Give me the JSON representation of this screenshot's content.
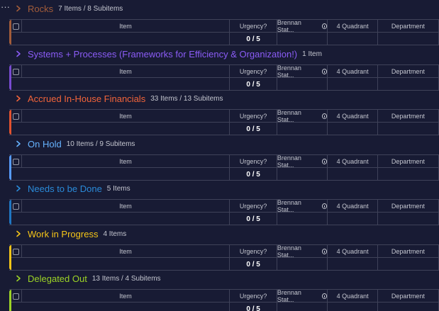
{
  "menu_glyph": "···",
  "columns": {
    "item": "Item",
    "urgency": "Urgency?",
    "brennan": "Brennan Stat...",
    "quadrant": "4 Quadrant",
    "department": "Department"
  },
  "groups": [
    {
      "title": "Rocks",
      "count": "7 Items / 8 Subitems",
      "progress": "0 / 5",
      "color": "#a25c3a",
      "title_color": "#a25c3a"
    },
    {
      "title": "Systems + Processes (Frameworks for Efficiency & Organization!)",
      "count": "1 Item",
      "progress": "0 / 5",
      "color": "#784bd1",
      "title_color": "#8b5cf6"
    },
    {
      "title": "Accrued In-House Financials",
      "count": "33 Items / 13 Subitems",
      "progress": "0 / 5",
      "color": "#e2522f",
      "title_color": "#f2643a"
    },
    {
      "title": "On Hold",
      "count": "10 Items / 9 Subitems",
      "progress": "0 / 5",
      "color": "#579bfc",
      "title_color": "#66b3ff"
    },
    {
      "title": "Needs to be Done",
      "count": "5 Items",
      "progress": "0 / 5",
      "color": "#1f76c2",
      "title_color": "#2a8ad8"
    },
    {
      "title": "Work in Progress",
      "count": "4 Items",
      "progress": "0 / 5",
      "color": "#f5c518",
      "title_color": "#f5c518"
    },
    {
      "title": "Delegated Out",
      "count": "13 Items / 4 Subitems",
      "progress": "0 / 5",
      "color": "#9cd326",
      "title_color": "#9cd326"
    }
  ]
}
